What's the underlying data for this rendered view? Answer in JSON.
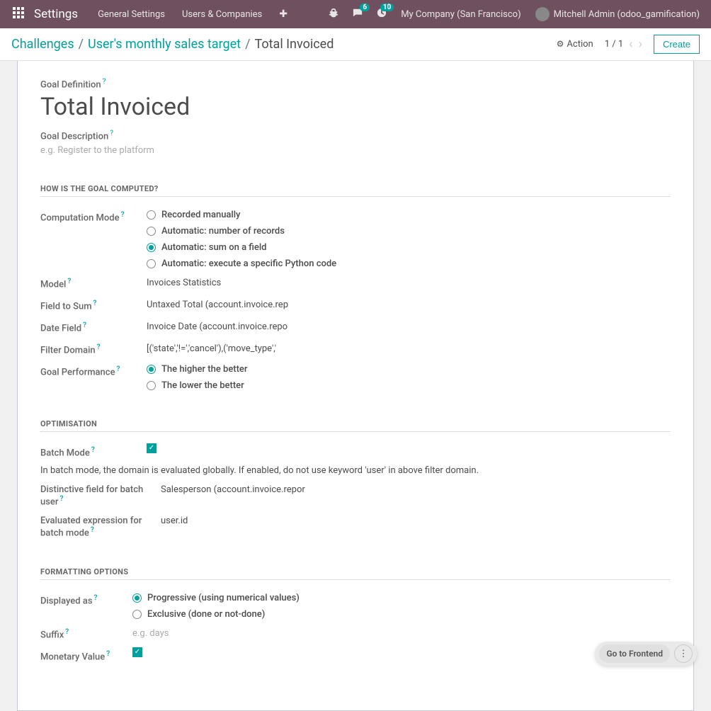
{
  "navbar": {
    "brand": "Settings",
    "links": [
      "General Settings",
      "Users & Companies"
    ],
    "messages_badge": "6",
    "activities_badge": "10",
    "company": "My Company (San Francisco)",
    "user": "Mitchell Admin (odoo_gamification)"
  },
  "breadcrumb": {
    "items": [
      "Challenges",
      "User's monthly sales target"
    ],
    "current": "Total Invoiced"
  },
  "controls": {
    "action": "Action",
    "pager": "1 / 1",
    "create": "Create"
  },
  "form": {
    "goal_definition_label": "Goal Definition",
    "title": "Total Invoiced",
    "goal_description_label": "Goal Description",
    "goal_description_placeholder": "e.g. Register to the platform",
    "section_compute": "HOW IS THE GOAL COMPUTED?",
    "computation_mode_label": "Computation Mode",
    "computation_options": [
      "Recorded manually",
      "Automatic: number of records",
      "Automatic: sum on a field",
      "Automatic: execute a specific Python code"
    ],
    "computation_selected": 2,
    "model_label": "Model",
    "model_value": "Invoices Statistics",
    "field_to_sum_label": "Field to Sum",
    "field_to_sum_value": "Untaxed Total (account.invoice.rep",
    "date_field_label": "Date Field",
    "date_field_value": "Invoice Date (account.invoice.repo",
    "filter_domain_label": "Filter Domain",
    "filter_domain_value": "[('state','!=','cancel'),('move_type','",
    "goal_performance_label": "Goal Performance",
    "goal_performance_options": [
      "The higher the better",
      "The lower the better"
    ],
    "goal_performance_selected": 0,
    "section_optimisation": "OPTIMISATION",
    "batch_mode_label": "Batch Mode",
    "batch_mode_checked": true,
    "batch_note": "In batch mode, the domain is evaluated globally. If enabled, do not use keyword 'user' in above filter domain.",
    "distinctive_field_label": "Distinctive field for batch user",
    "distinctive_field_value": "Salesperson (account.invoice.repor",
    "evaluated_expr_label": "Evaluated expression for batch mode",
    "evaluated_expr_value": "user.id",
    "section_formatting": "FORMATTING OPTIONS",
    "displayed_as_label": "Displayed as",
    "displayed_as_options": [
      "Progressive (using numerical values)",
      "Exclusive (done or not-done)"
    ],
    "displayed_as_selected": 0,
    "suffix_label": "Suffix",
    "suffix_placeholder": "e.g. days",
    "monetary_label": "Monetary Value",
    "monetary_checked": true
  },
  "floating": {
    "goto": "Go to Frontend"
  }
}
